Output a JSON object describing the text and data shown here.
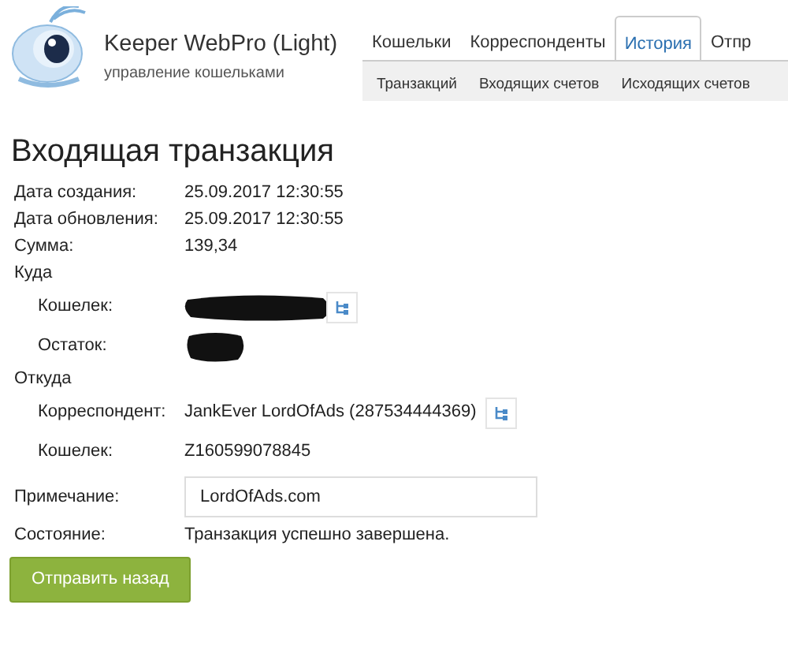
{
  "app": {
    "title": "Keeper WebPro (Light)",
    "subtitle": "управление кошельками"
  },
  "tabs": [
    {
      "label": "Кошельки",
      "selected": false
    },
    {
      "label": "Корреспонденты",
      "selected": false
    },
    {
      "label": "История",
      "selected": true
    },
    {
      "label": "Отпр",
      "selected": false
    }
  ],
  "subtabs": [
    {
      "label": "Транзакций"
    },
    {
      "label": "Входящих счетов"
    },
    {
      "label": "Исходящих счетов"
    }
  ],
  "heading": "Входящая транзакция",
  "rows": [
    {
      "kind": "field",
      "label": "Дата создания:",
      "value": "25.09.2017 12:30:55"
    },
    {
      "kind": "field",
      "label": "Дата обновления:",
      "value": "25.09.2017 12:30:55"
    },
    {
      "kind": "field",
      "label": "Сумма:",
      "value": "139,34"
    },
    {
      "kind": "section",
      "label": "Куда"
    },
    {
      "kind": "redacted",
      "label": "Кошелек:",
      "button": true
    },
    {
      "kind": "redacted",
      "label": "Остаток:",
      "button": false
    },
    {
      "kind": "section",
      "label": "Откуда"
    },
    {
      "kind": "subfield",
      "label": "Корреспондент:",
      "value": "JankEver LordOfAds (287534444369)",
      "button": true
    },
    {
      "kind": "subfield",
      "label": "Кошелек:",
      "value": "Z160599078845"
    },
    {
      "kind": "input",
      "label": "Примечание:",
      "value": "LordOfAds.com"
    },
    {
      "kind": "field",
      "label": "Состояние:",
      "value": "Транзакция успешно завершена."
    }
  ],
  "send_back_button": "Отправить назад"
}
